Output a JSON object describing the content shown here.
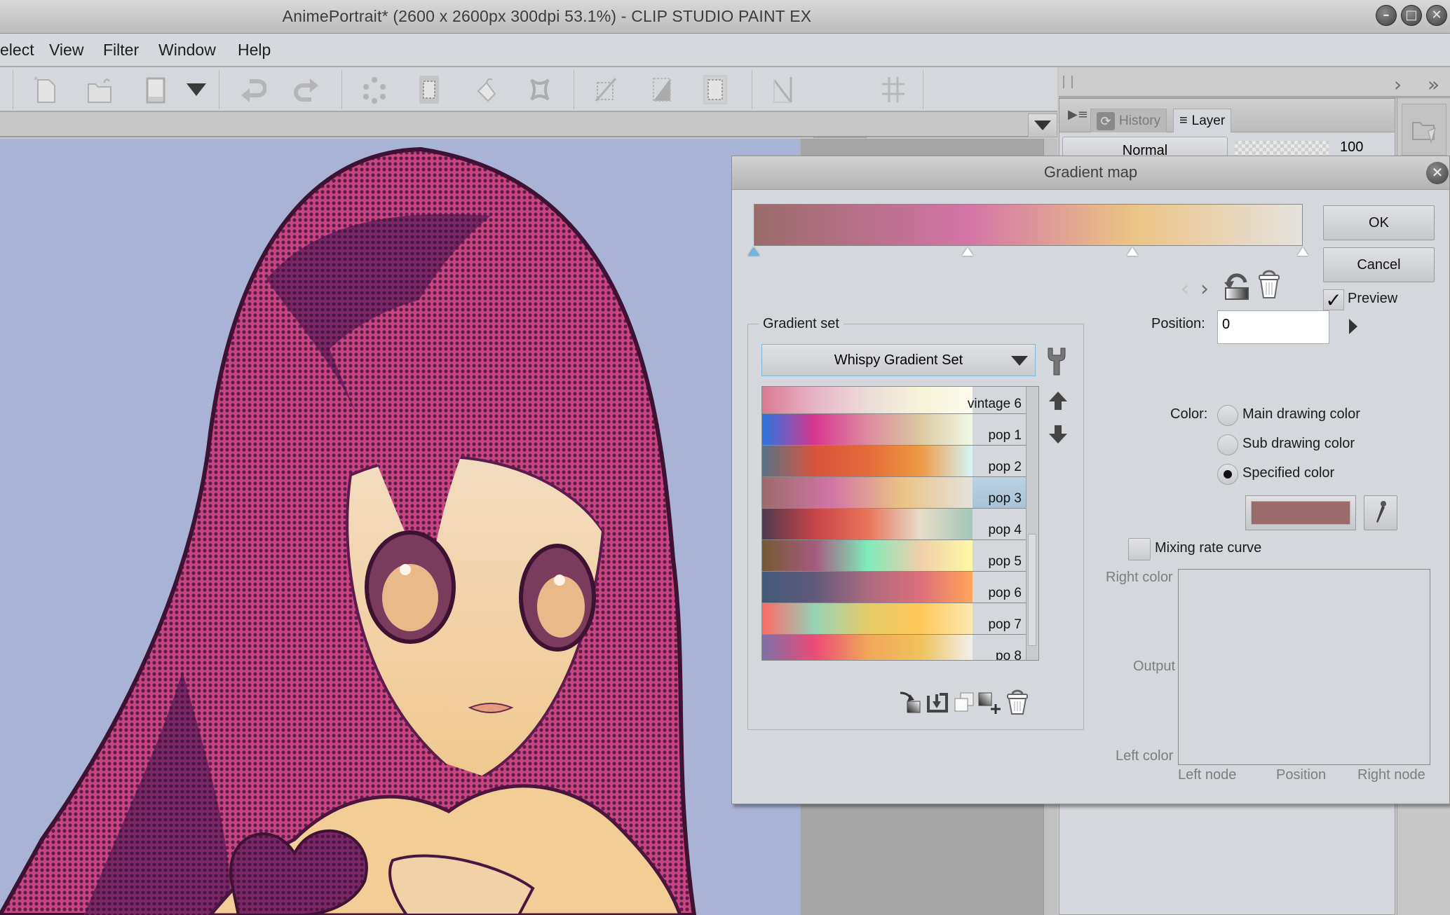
{
  "window": {
    "title": "AnimePortrait* (2600 x 2600px 300dpi 53.1%)  - CLIP STUDIO PAINT EX",
    "controls": [
      "minimize",
      "maximize",
      "close"
    ]
  },
  "menu": {
    "items": [
      "elect",
      "View",
      "Filter",
      "Window",
      "Help"
    ]
  },
  "toolbar": {
    "icons": [
      "new-file",
      "open-file",
      "save",
      "save-dropdown",
      "undo",
      "redo",
      "clear-selection",
      "select-all",
      "fill-selection",
      "transform",
      "ruler-snap",
      "special-ruler-snap",
      "grid-snap",
      "snap-to-ruler",
      "snap-to-special-ruler",
      "snap-to-grid",
      "help"
    ]
  },
  "right_panel": {
    "tabs": [
      {
        "label": "History",
        "active": false
      },
      {
        "label": "Layer",
        "active": true
      }
    ],
    "blend_mode": "Normal",
    "opacity": "100"
  },
  "dialog": {
    "title": "Gradient map",
    "ok_label": "OK",
    "cancel_label": "Cancel",
    "preview_label": "Preview",
    "preview_checked": true,
    "gradient": {
      "stops": [
        {
          "position": 0,
          "color": "#9b6b6b",
          "selected": true
        },
        {
          "position": 39,
          "color": "#d275a6",
          "selected": false
        },
        {
          "position": 69,
          "color": "#ecc485",
          "selected": false
        },
        {
          "position": 100,
          "color": "#e4e2de",
          "selected": false
        }
      ]
    },
    "gradient_set": {
      "group_label": "Gradient set",
      "selected_set": "Whispy Gradient Set",
      "items": [
        {
          "name": "vintage 6",
          "colors": [
            "#d97a92",
            "#e8b4c8",
            "#eadcd8",
            "#f6f3d6",
            "#fdfbf0"
          ],
          "selected": false
        },
        {
          "name": "pop 1",
          "colors": [
            "#2a74e0",
            "#d9378f",
            "#dd8aa0",
            "#dcc9a0",
            "#f1f8e8"
          ],
          "selected": false
        },
        {
          "name": "pop 2",
          "colors": [
            "#567286",
            "#d9543c",
            "#e46a39",
            "#ee9942",
            "#d6f6f8"
          ],
          "selected": false
        },
        {
          "name": "pop 3",
          "colors": [
            "#9b6b6b",
            "#d275a6",
            "#ecc485",
            "#e4e2de"
          ],
          "selected": true
        },
        {
          "name": "pop 4",
          "colors": [
            "#503b4e",
            "#c74447",
            "#e8745a",
            "#e6dcc8",
            "#a5c6b8"
          ],
          "selected": false
        },
        {
          "name": "pop 5",
          "colors": [
            "#745a33",
            "#a55a7e",
            "#7eecbc",
            "#f0cfaa",
            "#fdf9a6"
          ],
          "selected": false
        },
        {
          "name": "pop 6",
          "colors": [
            "#41597a",
            "#625a7a",
            "#ab6b80",
            "#dd6f7a",
            "#ffa55a"
          ],
          "selected": false
        },
        {
          "name": "pop 7",
          "colors": [
            "#ff6a66",
            "#94d2b7",
            "#e6cc68",
            "#ffc85a",
            "#fde8b0"
          ],
          "selected": false
        },
        {
          "name": "po 8",
          "colors": [
            "#7c72a8",
            "#ec4a77",
            "#f1a65a",
            "#f0c25a",
            "#f2f0ec"
          ],
          "selected": false
        }
      ]
    },
    "position_label": "Position:",
    "position_value": "0",
    "color_label": "Color:",
    "color_options": [
      {
        "label": "Main drawing color",
        "checked": false
      },
      {
        "label": "Sub drawing color",
        "checked": false
      },
      {
        "label": "Specified color",
        "checked": true
      }
    ],
    "specified_color": "#9b6b6b",
    "mixing_rate_label": "Mixing rate curve",
    "mixing_rate_checked": false,
    "curve_labels": {
      "right_color": "Right color",
      "output": "Output",
      "left_color": "Left color",
      "left_node": "Left node",
      "position": "Position",
      "right_node": "Right node"
    }
  },
  "canvas": {
    "background_color": "#a9b3d6",
    "hair_color": "#8b2a6e",
    "skin_color": "#f0cf9c"
  }
}
